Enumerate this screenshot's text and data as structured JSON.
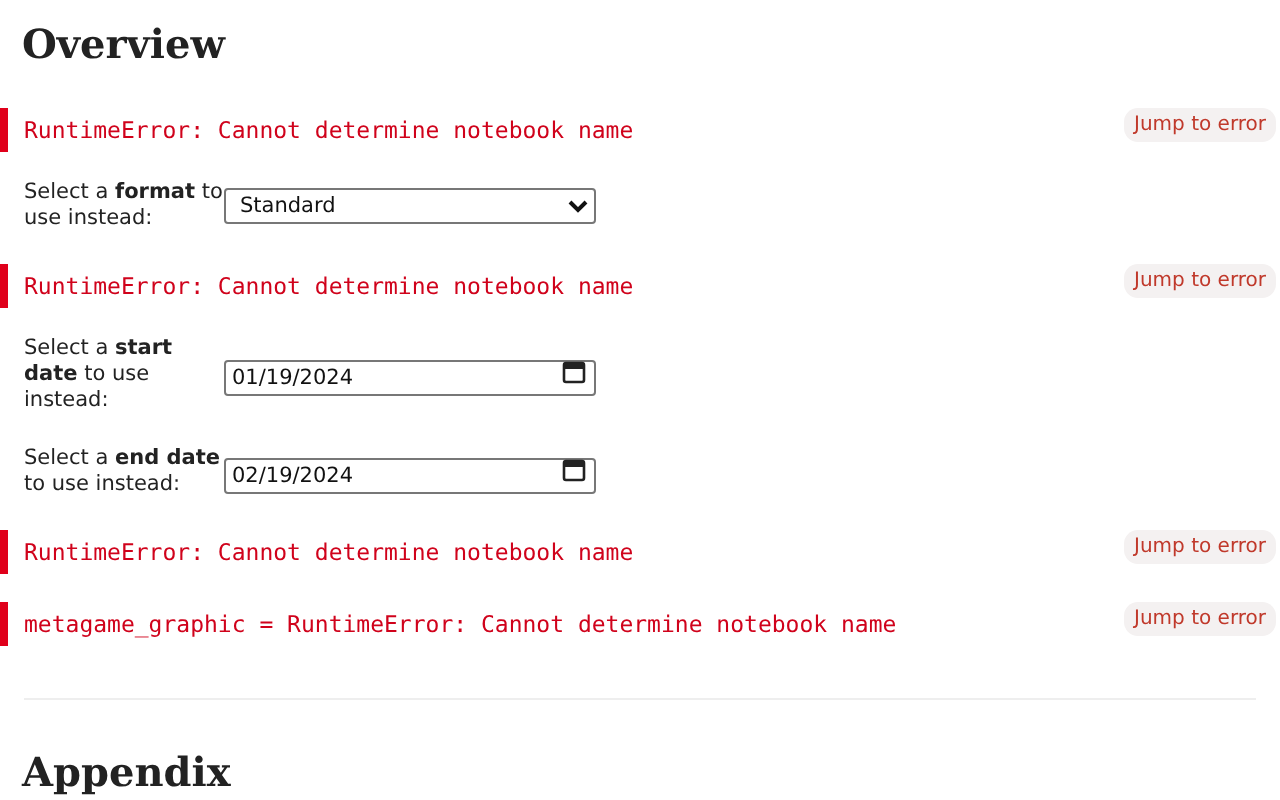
{
  "heading": "Overview",
  "blocks": [
    {
      "kind": "error",
      "message": "RuntimeError: Cannot determine notebook name",
      "action": "Jump to error"
    },
    {
      "kind": "select",
      "label": "Select a **format** to use instead:",
      "value": "Standard"
    },
    {
      "kind": "error",
      "message": "RuntimeError: Cannot determine notebook name",
      "action": "Jump to error"
    },
    {
      "kind": "date",
      "label": "Select a **start date** to use instead:",
      "value": "01/19/2024"
    },
    {
      "kind": "date",
      "label": "Select a **end date** to use instead:",
      "value": "02/19/2024"
    },
    {
      "kind": "error",
      "message": "RuntimeError: Cannot determine notebook name",
      "action": "Jump to error"
    },
    {
      "kind": "error",
      "message": "metagame_graphic = RuntimeError: Cannot determine notebook name",
      "action": "Jump to error"
    }
  ],
  "appendix_heading": "Appendix"
}
